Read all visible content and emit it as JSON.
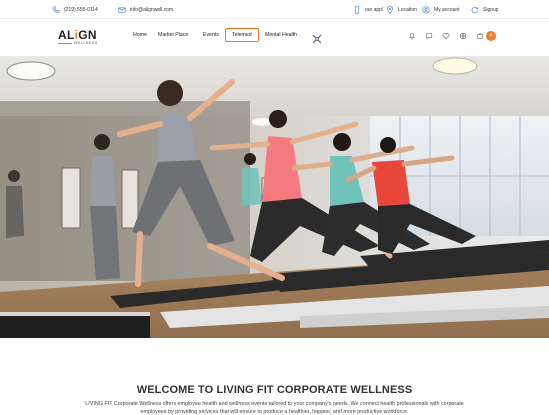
{
  "topbar": {
    "phone": "(219) 555-0114",
    "email": "info@alignwell.com",
    "links": [
      "our app!",
      "Location",
      "My account",
      "Signup"
    ]
  },
  "brand": {
    "logo_main_a": "AL",
    "logo_main_i": "i",
    "logo_main_b": "GN",
    "logo_sub": "WELLNESS",
    "accent": "#f07b2b"
  },
  "nav": {
    "items": [
      "Home",
      "Market Place",
      "Events",
      "Telemed",
      "Mental Health"
    ],
    "active": "Telemed",
    "avatar_initial": "A"
  },
  "icons": {
    "topbar": [
      "phone-icon",
      "mail-icon",
      "mobile-icon",
      "location-pin-icon",
      "user-icon",
      "signup-icon"
    ],
    "nav": [
      "bell-icon",
      "chat-icon",
      "heart-icon",
      "globe-icon",
      "cart-icon"
    ]
  },
  "welcome": {
    "title": "WELCOME TO LIVING FIT CORPORATE WELLNESS",
    "text": "LIVING FIT Corporate Wellness offers employee health and wellness events tailored to your company's needs. We connect health professionals with corporate employees by providing services that will ensure to produce a healthier, happier, and more productive workforce."
  }
}
